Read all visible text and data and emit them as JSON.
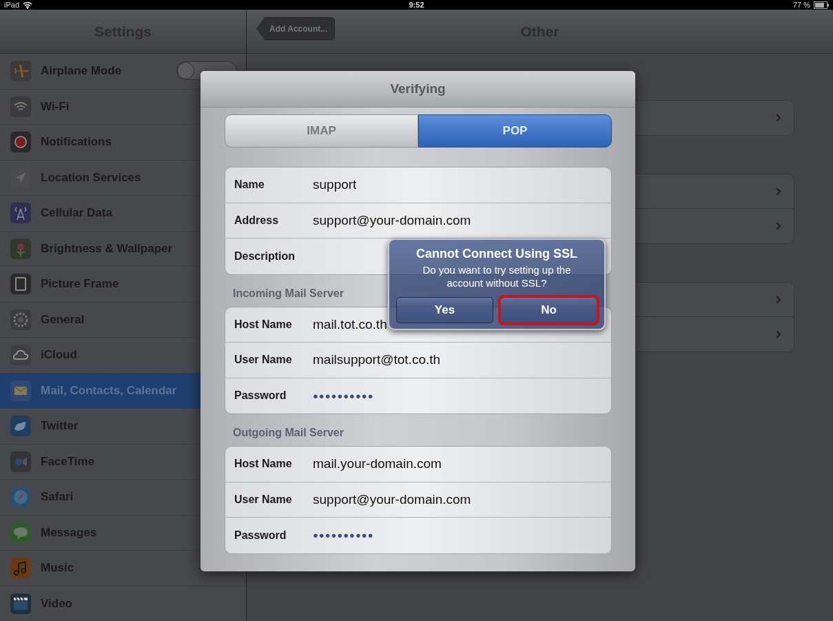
{
  "status_bar": {
    "device": "iPad",
    "time": "9:52",
    "battery": "77 %"
  },
  "sidebar": {
    "title": "Settings",
    "items": [
      {
        "label": "Airplane Mode",
        "kind": "toggle",
        "on": false,
        "selected": false
      },
      {
        "label": "Wi-Fi",
        "kind": "link",
        "selected": false
      },
      {
        "label": "Notifications",
        "kind": "link",
        "selected": false
      },
      {
        "label": "Location Services",
        "kind": "link",
        "selected": false
      },
      {
        "label": "Cellular Data",
        "kind": "link",
        "selected": false
      },
      {
        "label": "Brightness & Wallpaper",
        "kind": "link",
        "selected": false
      },
      {
        "label": "Picture Frame",
        "kind": "link",
        "selected": false
      },
      {
        "label": "General",
        "kind": "link",
        "selected": false
      },
      {
        "label": "iCloud",
        "kind": "link",
        "selected": false
      },
      {
        "label": "Mail, Contacts, Calendar",
        "kind": "link",
        "selected": true
      },
      {
        "label": "Twitter",
        "kind": "link",
        "selected": false
      },
      {
        "label": "FaceTime",
        "kind": "link",
        "selected": false
      },
      {
        "label": "Safari",
        "kind": "link",
        "selected": false
      },
      {
        "label": "Messages",
        "kind": "link",
        "selected": false
      },
      {
        "label": "Music",
        "kind": "link",
        "selected": false
      },
      {
        "label": "Video",
        "kind": "link",
        "selected": false
      }
    ]
  },
  "detail": {
    "back_button": "Add Account...",
    "title": "Other"
  },
  "sheet": {
    "title": "Verifying",
    "segments": [
      {
        "label": "IMAP",
        "selected": false
      },
      {
        "label": "POP",
        "selected": true
      }
    ],
    "sections": [
      {
        "fields": [
          {
            "label": "Name",
            "kind": "text",
            "value": "support"
          },
          {
            "label": "Address",
            "kind": "text",
            "value": "support@your-domain.com"
          },
          {
            "label": "Description"
          }
        ]
      },
      {
        "header": "Incoming Mail Server",
        "fields": [
          {
            "label": "Host Name",
            "kind": "text",
            "value": "mail.tot.co.th"
          },
          {
            "label": "User Name",
            "kind": "text",
            "value": "mailsupport@tot.co.th"
          },
          {
            "label": "Password",
            "kind": "password",
            "value": "●●●●●●●●●●"
          }
        ]
      },
      {
        "header": "Outgoing Mail Server",
        "fields": [
          {
            "label": "Host Name",
            "kind": "text",
            "value": "mail.your-domain.com"
          },
          {
            "label": "User Name",
            "kind": "text",
            "value": "support@your-domain.com"
          },
          {
            "label": "Password",
            "kind": "password",
            "value": "●●●●●●●●●●"
          }
        ]
      }
    ]
  },
  "alert": {
    "title": "Cannot Connect Using SSL",
    "message": "Do you want to try setting up the account without SSL?",
    "buttons": [
      {
        "label": "Yes",
        "highlighted": false
      },
      {
        "label": "No",
        "highlighted": true
      }
    ]
  }
}
